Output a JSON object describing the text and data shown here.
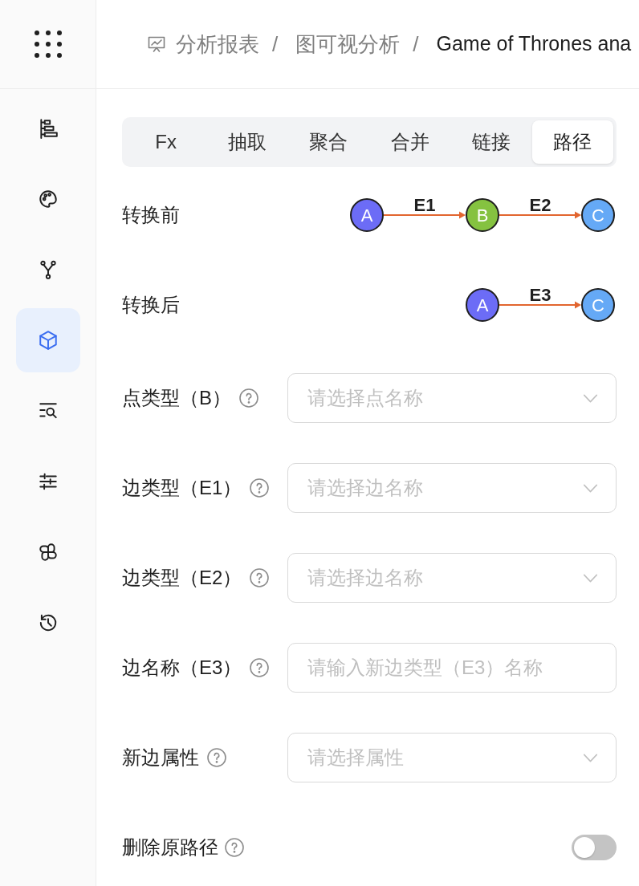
{
  "sidebar": {
    "items": [
      {
        "selected": false
      },
      {
        "selected": false
      },
      {
        "selected": false
      },
      {
        "selected": true
      },
      {
        "selected": false
      },
      {
        "selected": false
      },
      {
        "selected": false
      },
      {
        "selected": false
      }
    ]
  },
  "breadcrumb": {
    "items": [
      "分析报表",
      "图可视分析",
      "Game of Thrones ana"
    ],
    "separators": [
      "/",
      "/"
    ]
  },
  "tabs": [
    {
      "label": "Fx",
      "selected": false
    },
    {
      "label": "抽取",
      "selected": false
    },
    {
      "label": "聚合",
      "selected": false
    },
    {
      "label": "合并",
      "selected": false
    },
    {
      "label": "链接",
      "selected": false
    },
    {
      "label": "路径",
      "selected": true
    }
  ],
  "path_preview": [
    {
      "label": "转换前",
      "nodes": [
        {
          "label": "A",
          "color": "#6c6cf6"
        },
        {
          "label": "B",
          "color": "#85c240"
        },
        {
          "label": "C",
          "color": "#65a9f6"
        }
      ],
      "edges": [
        {
          "label": "E1"
        },
        {
          "label": "E2"
        }
      ]
    },
    {
      "label": "转换后",
      "nodes": [
        {
          "label": "A",
          "color": "#6c6cf6"
        },
        {
          "label": "C",
          "color": "#65a9f6"
        }
      ],
      "edges": [
        {
          "label": "E3"
        }
      ]
    }
  ],
  "form": [
    {
      "kind": "select",
      "label": "点类型（B）",
      "placeholder": "请选择点名称"
    },
    {
      "kind": "select",
      "label": "边类型（E1）",
      "placeholder": "请选择边名称"
    },
    {
      "kind": "select",
      "label": "边类型（E2）",
      "placeholder": "请选择边名称"
    },
    {
      "kind": "input",
      "label": "边名称（E3）",
      "placeholder": "请输入新边类型（E3）名称"
    },
    {
      "kind": "select",
      "label": "新边属性",
      "placeholder": "请选择属性"
    },
    {
      "kind": "switch",
      "label": "删除原路径",
      "on": false
    }
  ]
}
